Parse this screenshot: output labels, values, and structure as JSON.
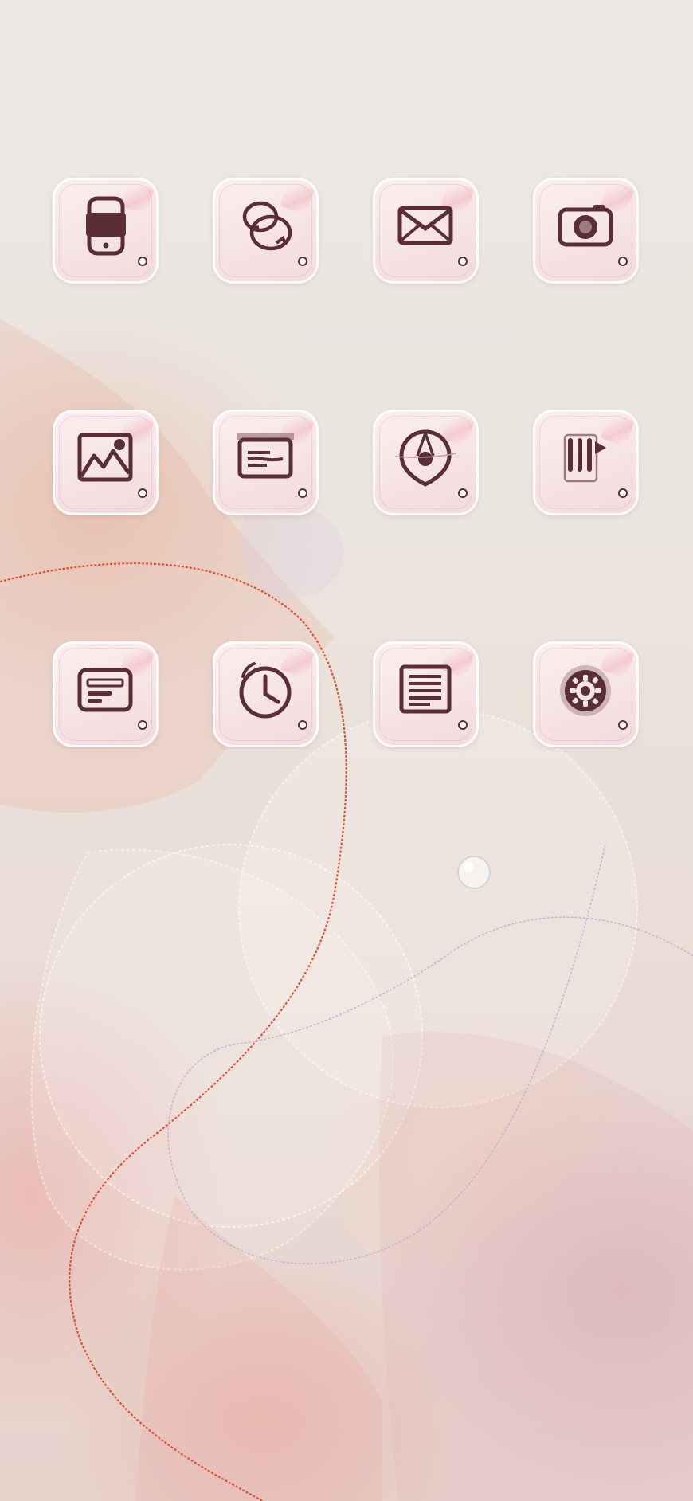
{
  "screen": {
    "type": "home-screen",
    "accent_color": "#5a2e35",
    "icon_background": "#f6e3e5"
  },
  "apps": [
    {
      "icon": "phone-icon"
    },
    {
      "icon": "chat-bubbles-icon"
    },
    {
      "icon": "mail-icon"
    },
    {
      "icon": "camera-icon"
    },
    {
      "icon": "gallery-icon"
    },
    {
      "icon": "browser-icon"
    },
    {
      "icon": "compass-icon"
    },
    {
      "icon": "music-icon"
    },
    {
      "icon": "calendar-icon"
    },
    {
      "icon": "clock-icon"
    },
    {
      "icon": "notes-icon"
    },
    {
      "icon": "settings-icon"
    }
  ]
}
